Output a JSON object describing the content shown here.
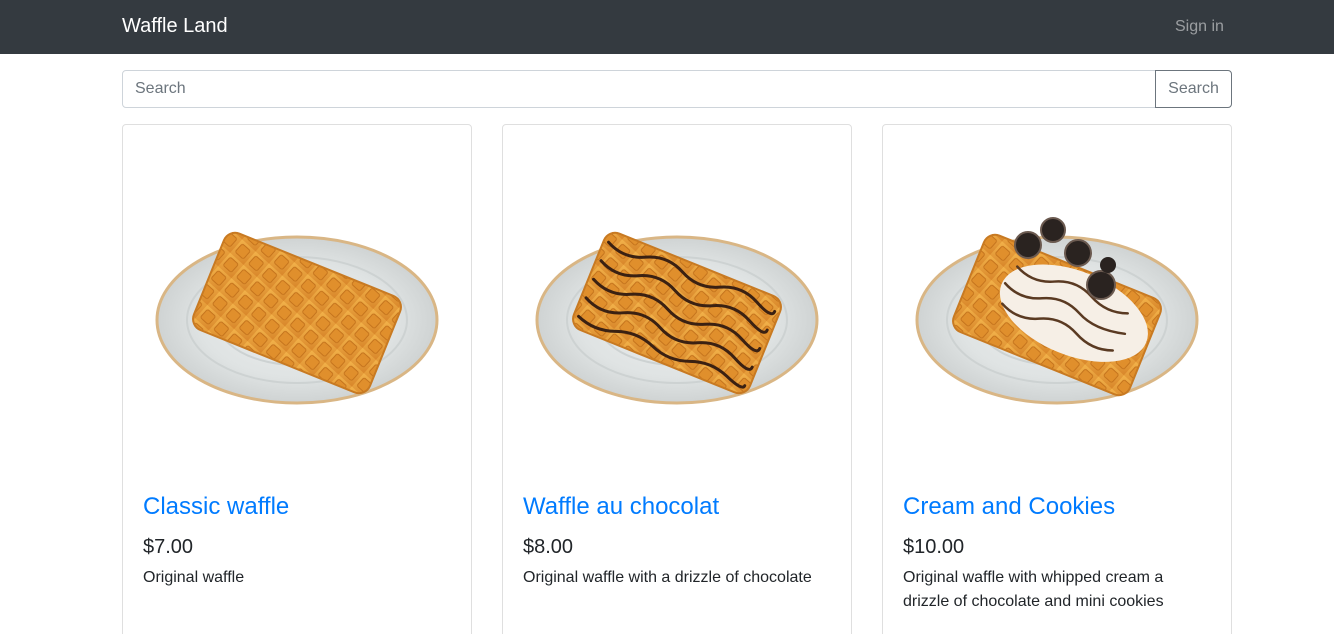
{
  "navbar": {
    "brand": "Waffle Land",
    "sign_in": "Sign in"
  },
  "search": {
    "placeholder": "Search",
    "button_label": "Search"
  },
  "products": [
    {
      "title": "Classic waffle",
      "price": "$7.00",
      "description": "Original waffle",
      "image": "classic-waffle-icon"
    },
    {
      "title": "Waffle au chocolat",
      "price": "$8.00",
      "description": "Original waffle with a drizzle of chocolate",
      "image": "chocolate-waffle-icon"
    },
    {
      "title": "Cream and Cookies",
      "price": "$10.00",
      "description": "Original waffle with whipped cream a drizzle of chocolate and mini cookies",
      "image": "cream-cookies-waffle-icon"
    }
  ],
  "colors": {
    "navbar": "#343a40",
    "link": "#007bff",
    "waffle": "#e8a23a",
    "chocolate": "#3b2112",
    "plate": "#e3e6e6"
  }
}
